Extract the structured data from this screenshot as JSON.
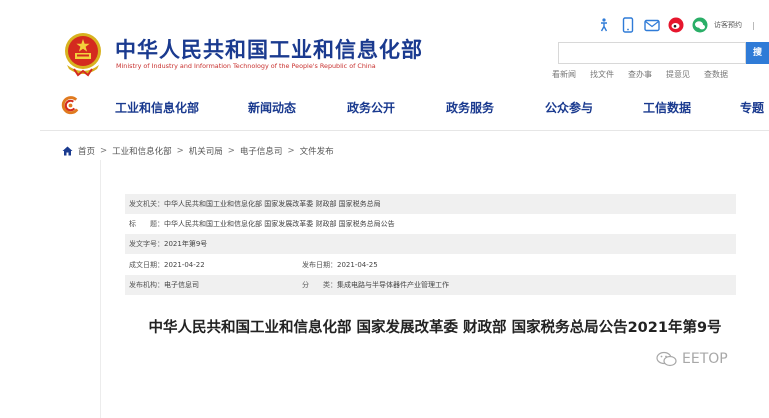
{
  "header": {
    "title": "中华人民共和国工业和信息化部",
    "subtitle": "Ministry of Industry and Information Technology of the People's Republic of China",
    "visitor_label": "访客预约",
    "visitor_sep": "|",
    "search": {
      "placeholder": "",
      "button_label": "搜"
    },
    "quick_links": [
      "看新闻",
      "找文件",
      "查办事",
      "提意见",
      "查数据"
    ]
  },
  "nav": {
    "items": [
      "工业和信息化部",
      "新闻动态",
      "政务公开",
      "政务服务",
      "公众参与",
      "工信数据",
      "专题"
    ]
  },
  "breadcrumb": [
    "首页",
    "工业和信息化部",
    "机关司局",
    "电子信息司",
    "文件发布"
  ],
  "breadcrumb_sep": ">",
  "meta": {
    "issuer_label": "发文机关：",
    "issuer": "中华人民共和国工业和信息化部 国家发展改革委 财政部 国家税务总局",
    "subject_label": "标　　题：",
    "subject": "中华人民共和国工业和信息化部 国家发展改革委 财政部 国家税务总局公告",
    "docno_label": "发文字号：",
    "docno": "2021年第9号",
    "created_label": "成文日期：",
    "created": "2021-04-22",
    "published_label": "发布日期：",
    "published": "2021-04-25",
    "org_label": "发布机构：",
    "org": "电子信息司",
    "category_label": "分　　类：",
    "category": "集成电路与半导体器件产业管理工作"
  },
  "doc_title": "中华人民共和国工业和信息化部 国家发展改革委 财政部 国家税务总局公告2021年第9号",
  "watermark": "EETOP",
  "colors": {
    "brand_blue": "#1a3a8f",
    "subtitle_red": "#c8312f",
    "search_blue": "#2f7bd7",
    "row_shade": "#f0f0f0",
    "weibo_red": "#e6162d",
    "wechat_green": "#2aae67"
  },
  "icons": [
    "emblem-icon",
    "accessibility-icon",
    "mobile-icon",
    "mail-icon",
    "weibo-icon",
    "wechat-icon",
    "nav-logo-icon",
    "home-icon",
    "wechat-watermark-icon"
  ]
}
